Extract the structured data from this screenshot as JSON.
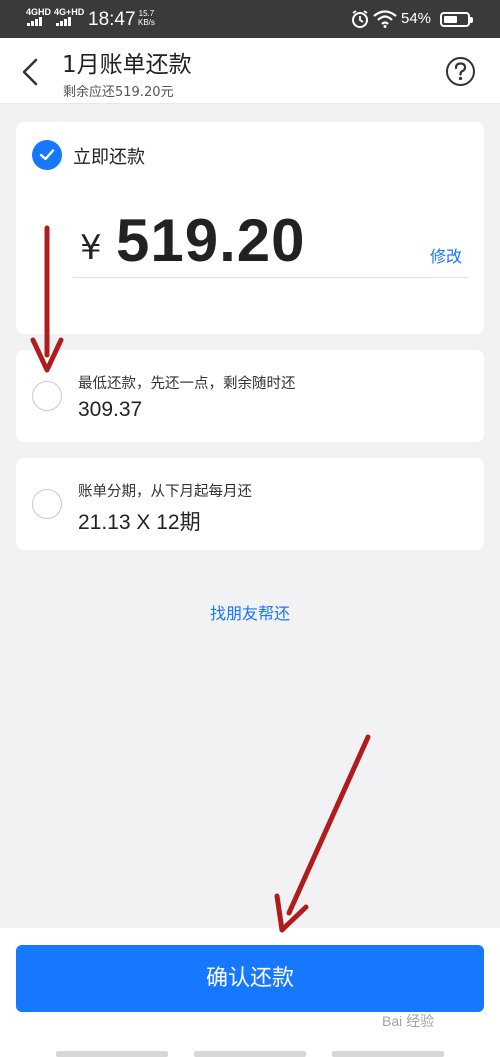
{
  "status_bar": {
    "network_1": "4GHD",
    "network_2": "4G+HD",
    "time": "18:47",
    "speed_value": "15.7",
    "speed_unit": "KB/s",
    "battery_percent": "54%",
    "battery_level": 0.54,
    "icons": [
      "signal-icon",
      "alarm-icon",
      "wifi-icon",
      "battery-icon"
    ]
  },
  "header": {
    "title": "1月账单还款",
    "subtitle": "剩余应还519.20元",
    "back_icon": "chevron-left-icon",
    "help_icon": "question-circle-icon"
  },
  "options": {
    "immediate": {
      "label": "立即还款",
      "selected": true,
      "currency_symbol": "¥",
      "amount": "519.20",
      "modify_label": "修改"
    },
    "minimum": {
      "label": "最低还款，先还一点，剩余随时还",
      "value": "309.37",
      "selected": false
    },
    "installment": {
      "label": "账单分期，从下月起每月还",
      "value": "21.13 X 12期",
      "selected": false
    }
  },
  "links": {
    "friend_pay": "找朋友帮还"
  },
  "actions": {
    "confirm_label": "确认还款"
  },
  "watermark": {
    "text": "Bai 经验"
  },
  "colors": {
    "accent": "#1677ff",
    "status_bar": "#3a3a3a",
    "background": "#f2f2f4",
    "annotation_arrow": "#b01c1c"
  }
}
